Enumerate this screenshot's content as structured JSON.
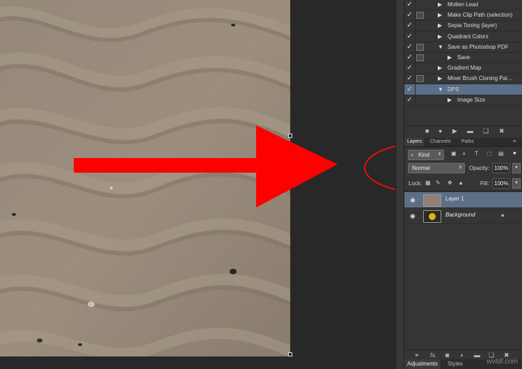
{
  "actions": [
    {
      "checked": true,
      "dialog": false,
      "expanded": false,
      "indent": 0,
      "label": "Molten Lead"
    },
    {
      "checked": true,
      "dialog": true,
      "expanded": false,
      "indent": 0,
      "label": "Make Clip Path (selection)"
    },
    {
      "checked": true,
      "dialog": false,
      "expanded": false,
      "indent": 0,
      "label": "Sepia Toning (layer)"
    },
    {
      "checked": true,
      "dialog": false,
      "expanded": false,
      "indent": 0,
      "label": "Quadrant Colors"
    },
    {
      "checked": true,
      "dialog": true,
      "expanded": true,
      "indent": 0,
      "label": "Save as Photoshop PDF"
    },
    {
      "checked": true,
      "dialog": true,
      "expanded": false,
      "indent": 1,
      "label": "Save"
    },
    {
      "checked": true,
      "dialog": false,
      "expanded": false,
      "indent": 0,
      "label": "Gradient Map"
    },
    {
      "checked": true,
      "dialog": true,
      "expanded": false,
      "indent": 0,
      "label": "Mixer Brush Cloning Pai..."
    },
    {
      "checked": true,
      "dialog": false,
      "expanded": true,
      "indent": 0,
      "label": "DPS",
      "selected": true
    },
    {
      "checked": true,
      "dialog": false,
      "expanded": false,
      "indent": 1,
      "label": "Image Size"
    }
  ],
  "panel_tabs": {
    "layers": "Layers",
    "channels": "Channels",
    "paths": "Paths"
  },
  "filter": {
    "kind": "Kind"
  },
  "blend": {
    "mode": "Normal",
    "opacity_label": "Opacity:",
    "opacity_value": "100%"
  },
  "lock": {
    "label": "Lock:",
    "fill_label": "Fill:",
    "fill_value": "100%"
  },
  "layers": [
    {
      "name": "Layer 1",
      "selected": true,
      "locked": false
    },
    {
      "name": "Background",
      "selected": false,
      "locked": true
    }
  ],
  "bottom_tabs": {
    "adjustments": "Adjustments",
    "styles": "Styles"
  },
  "watermark": "wvtdl.com",
  "annotation_color": "#ff0000"
}
